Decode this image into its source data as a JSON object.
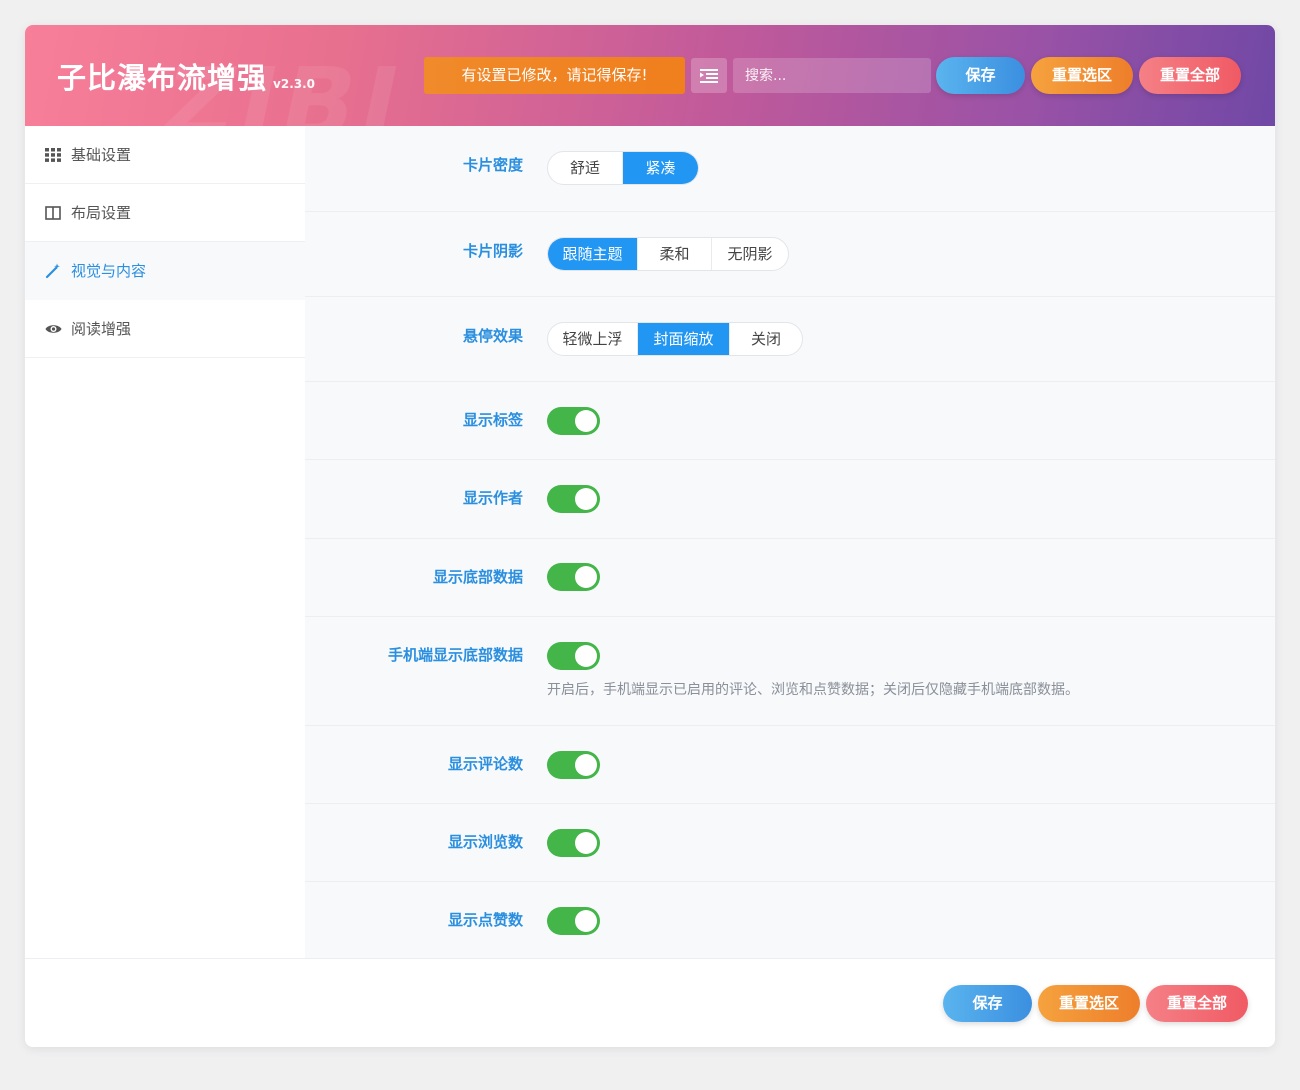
{
  "header": {
    "watermark": "ZIBI",
    "title": "子比瀑布流增强",
    "version": "v2.3.0",
    "notice": "有设置已修改，请记得保存!",
    "search_placeholder": "搜索...",
    "save_label": "保存",
    "reset_section_label": "重置选区",
    "reset_all_label": "重置全部"
  },
  "sidebar": {
    "items": [
      {
        "label": "基础设置",
        "icon": "grid-icon",
        "active": false
      },
      {
        "label": "布局设置",
        "icon": "columns-icon",
        "active": false
      },
      {
        "label": "视觉与内容",
        "icon": "magic-wand-icon",
        "active": true
      },
      {
        "label": "阅读增强",
        "icon": "eye-icon",
        "active": false
      }
    ]
  },
  "settings": {
    "card_density": {
      "label": "卡片密度",
      "options": [
        "舒适",
        "紧凑"
      ],
      "selected": "紧凑"
    },
    "card_shadow": {
      "label": "卡片阴影",
      "options": [
        "跟随主题",
        "柔和",
        "无阴影"
      ],
      "selected": "跟随主题"
    },
    "hover_effect": {
      "label": "悬停效果",
      "options": [
        "轻微上浮",
        "封面缩放",
        "关闭"
      ],
      "selected": "封面缩放"
    },
    "show_tags": {
      "label": "显示标签",
      "on": true
    },
    "show_author": {
      "label": "显示作者",
      "on": true
    },
    "show_footer_data": {
      "label": "显示底部数据",
      "on": true
    },
    "mobile_footer_data": {
      "label": "手机端显示底部数据",
      "on": true,
      "description": "开启后，手机端显示已启用的评论、浏览和点赞数据；关闭后仅隐藏手机端底部数据。"
    },
    "show_comments": {
      "label": "显示评论数",
      "on": true
    },
    "show_views": {
      "label": "显示浏览数",
      "on": true
    },
    "show_likes": {
      "label": "显示点赞数",
      "on": true
    }
  },
  "footer": {
    "save_label": "保存",
    "reset_section_label": "重置选区",
    "reset_all_label": "重置全部"
  },
  "colors": {
    "accent": "#2196f3",
    "toggle_on": "#43b549",
    "notice": "#f07f1d"
  }
}
